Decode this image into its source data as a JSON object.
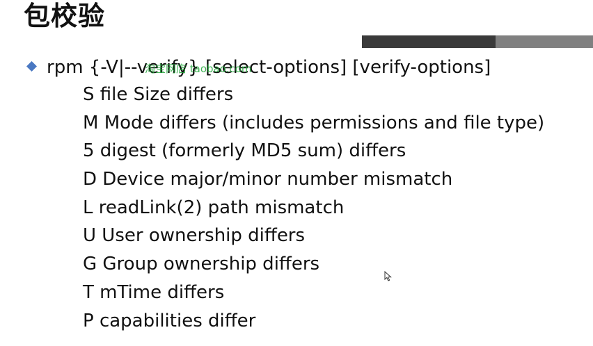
{
  "slide": {
    "title": "包校验",
    "command": "rpm {-V|--verify} [select-options] [verify-options]",
    "watermark": "淘宝网店 taobao.com",
    "options": [
      "S file Size differs",
      "M Mode differs (includes permissions and file type)",
      "5 digest (formerly MD5 sum) differs",
      "D Device major/minor number mismatch",
      "L readLink(2) path mismatch",
      "U User ownership differs",
      "G Group ownership differs",
      "T mTime differs",
      "P capabilities differ"
    ]
  },
  "colors": {
    "bullet": "#4a78c2",
    "bar_dark": "#3a3a3a",
    "bar_light": "#808080",
    "watermark": "#22a83a",
    "text": "#111111"
  },
  "icons": {
    "bullet": "diamond-bullet-icon",
    "cursor": "mouse-pointer-icon"
  }
}
